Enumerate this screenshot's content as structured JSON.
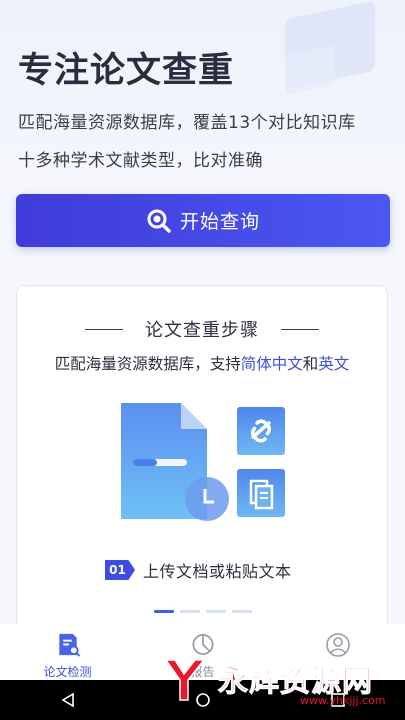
{
  "hero": {
    "title": "专注论文查重",
    "subtitle_line1": "匹配海量资源数据库，覆盖13个对比知识库",
    "subtitle_line2": "十多种学术文献类型，比对准确"
  },
  "start_button": {
    "label": "开始查询",
    "icon": "search-icon"
  },
  "steps_card": {
    "title": "论文查重步骤",
    "desc_prefix": "匹配海量资源数据库，支持",
    "desc_hl1": "简体中文",
    "desc_mid": "和",
    "desc_hl2": "英文",
    "step_number": "01",
    "step_text": "上传文档或粘贴文本",
    "carousel_active_index": 0,
    "carousel_count": 4
  },
  "tabbar": {
    "tabs": [
      {
        "label": "论文检测",
        "icon": "document-search-icon",
        "active": true
      },
      {
        "label": "报告",
        "icon": "pie-chart-icon",
        "active": false
      },
      {
        "label": "",
        "icon": "user-icon",
        "active": false
      }
    ]
  },
  "watermark": {
    "text": "永辉资源网",
    "url": "www.yhkjjj.com"
  },
  "colors": {
    "accent": "#3f4ce0",
    "highlight": "#3e4fd6",
    "inactive": "#8a8d99",
    "watermark": "#e8192c"
  }
}
